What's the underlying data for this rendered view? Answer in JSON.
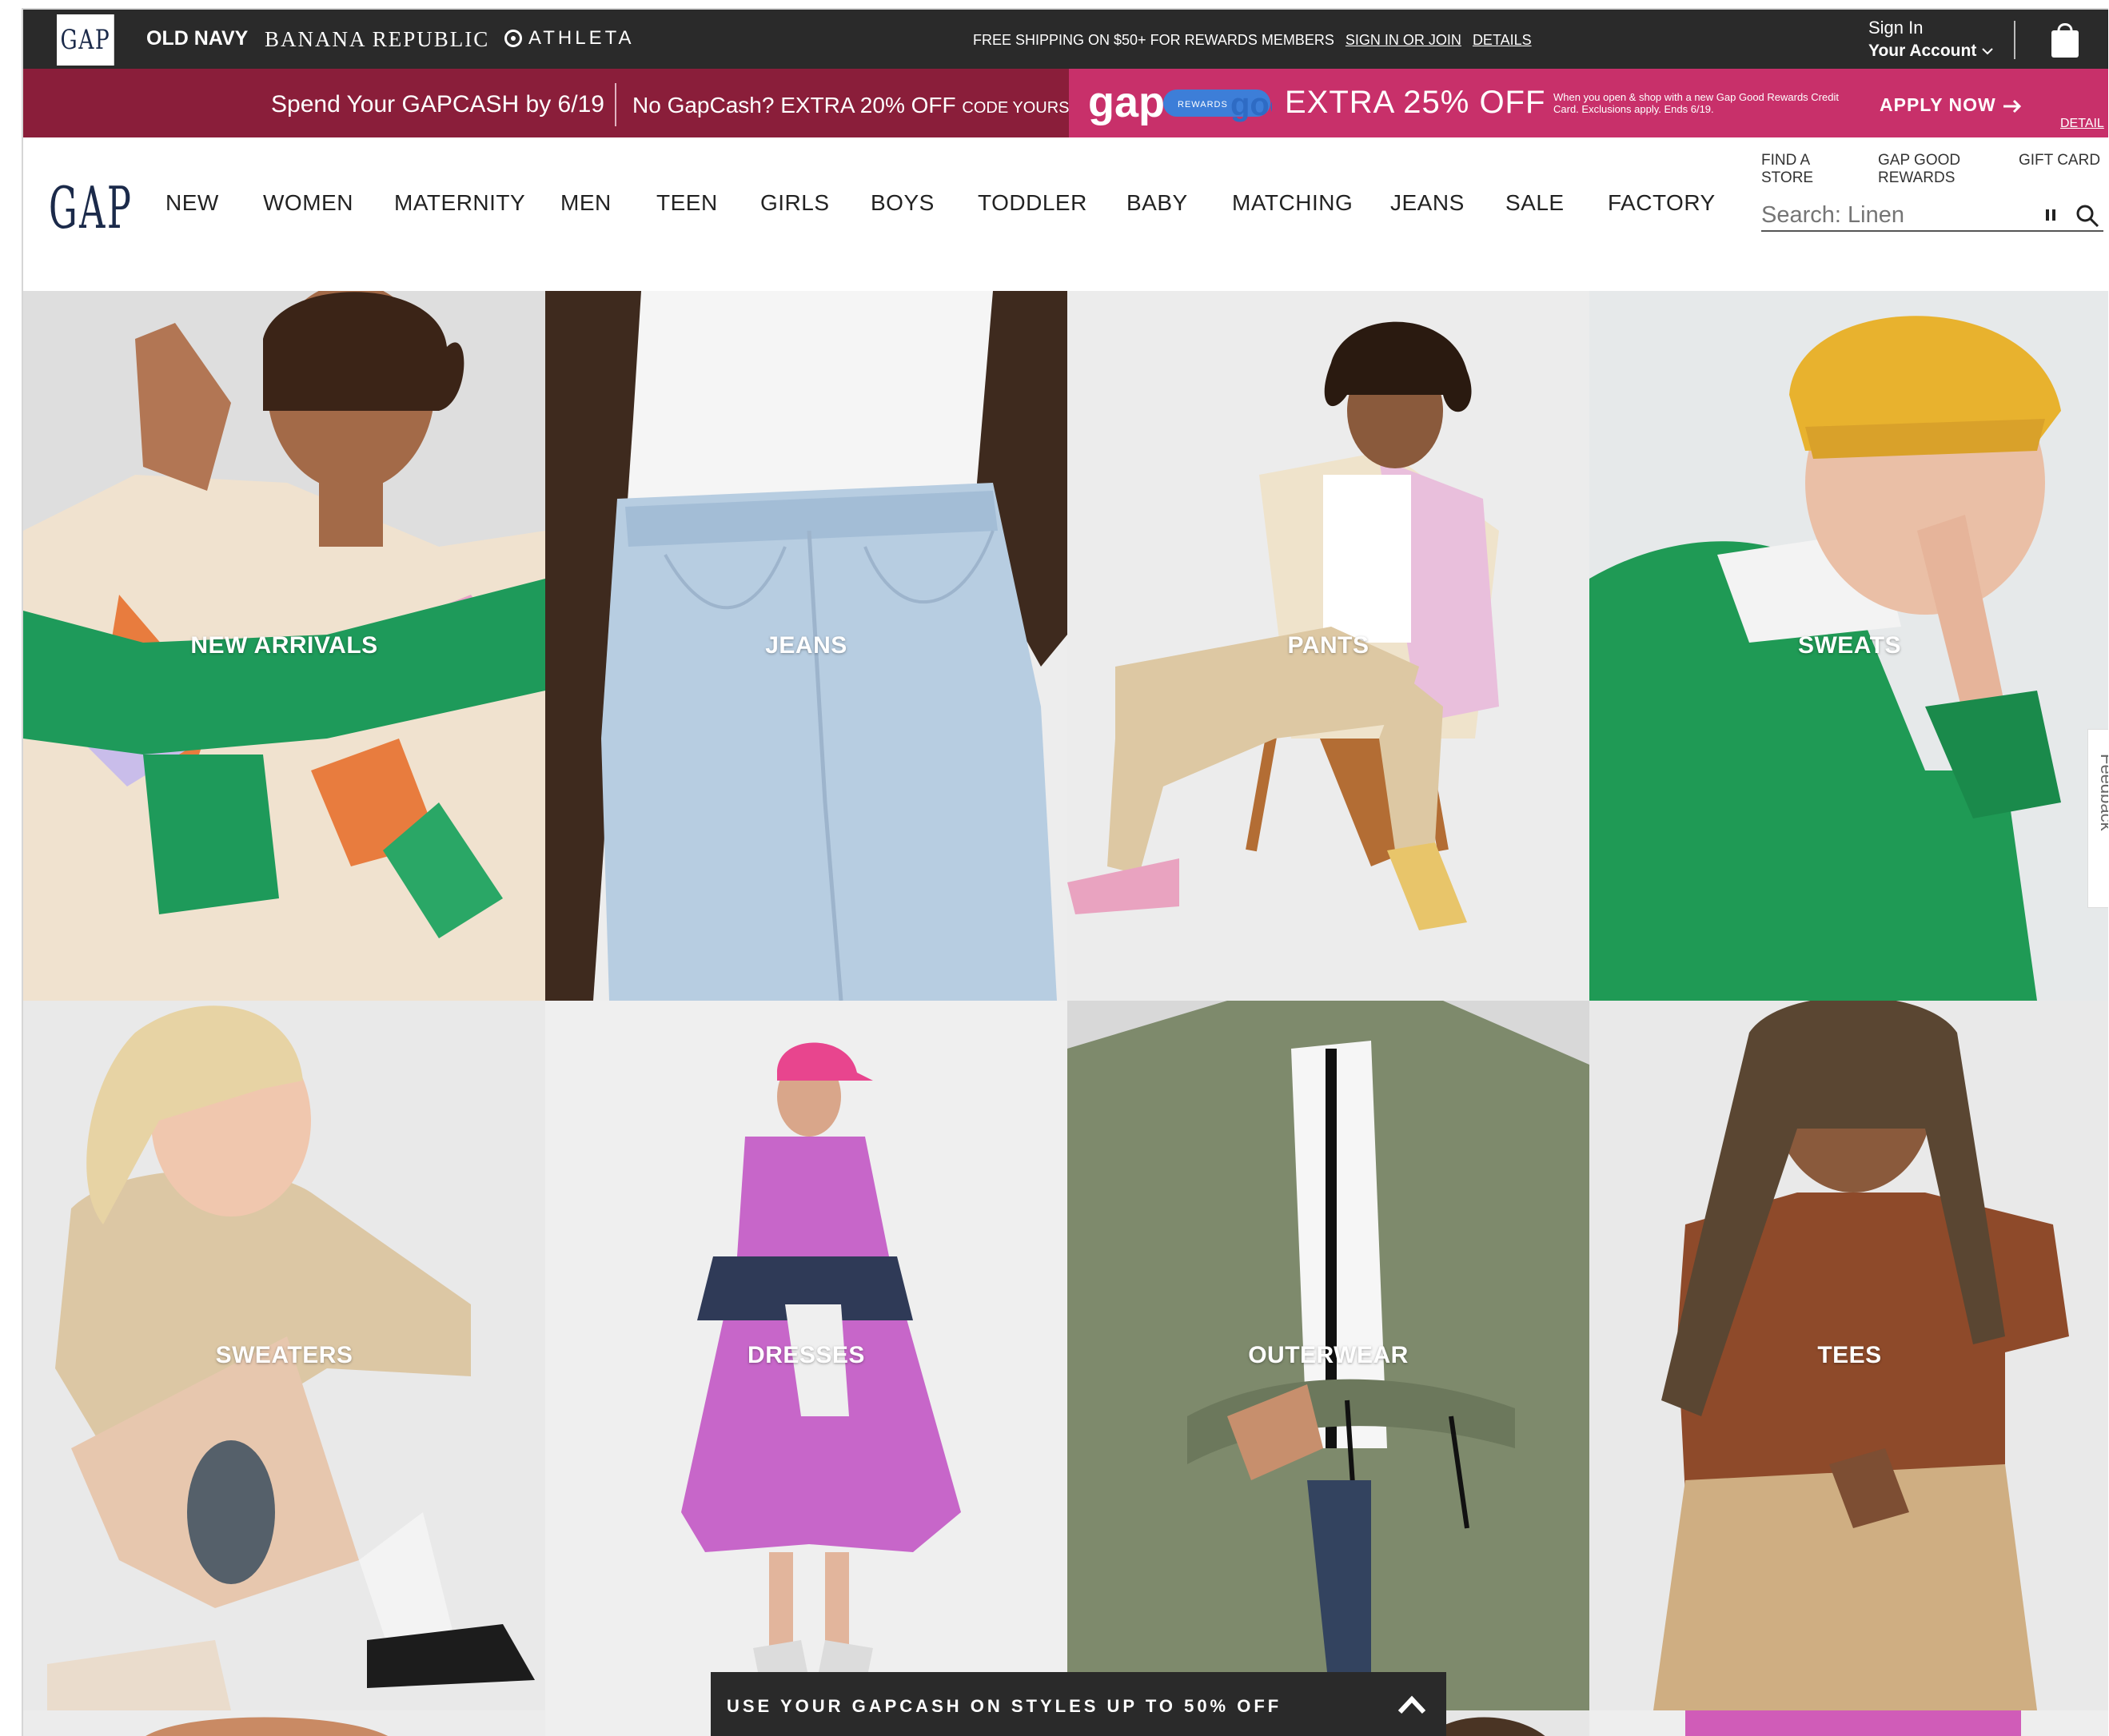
{
  "brand_bar": {
    "gap": "GAP",
    "old_navy": "OLD NAVY",
    "banana_republic": "BANANA REPUBLIC",
    "athleta": "ATHLETA",
    "shipping_text": "FREE SHIPPING ON $50+ FOR REWARDS MEMBERS",
    "sign_in_join": "SIGN IN OR JOIN",
    "details": "DETAILS",
    "sign_in": "Sign In",
    "your_account": "Your Account"
  },
  "promo_bar": {
    "spend_text": "Spend Your GAPCASH by 6/19",
    "no_gapcash": "No GapCash? EXTRA 20% OFF",
    "code": "CODE YOURS",
    "rewards_badge": "REWARDS",
    "extra_off": "EXTRA 25% OFF",
    "card_fine_print": "When you open & shop with a new Gap Good Rewards Credit Card. Exclusions apply. Ends 6/19.",
    "apply_now": "APPLY NOW",
    "details": "DETAIL"
  },
  "nav": {
    "logo": "GAP",
    "items": [
      "NEW",
      "WOMEN",
      "MATERNITY",
      "MEN",
      "TEEN",
      "GIRLS",
      "BOYS",
      "TODDLER",
      "BABY",
      "MATCHING",
      "JEANS",
      "SALE",
      "FACTORY"
    ],
    "find_store": "FIND A STORE",
    "gap_good_rewards": "GAP GOOD REWARDS",
    "gift_card": "GIFT CARD",
    "search_placeholder": "Search: Linen"
  },
  "tiles": [
    {
      "label": "NEW ARRIVALS",
      "bg": "#dcdcdc"
    },
    {
      "label": "JEANS",
      "bg": "#b9cde0"
    },
    {
      "label": "PANTS",
      "bg": "#ebebeb"
    },
    {
      "label": "SWEATS",
      "bg": "#e6e9ea"
    },
    {
      "label": "SWEATERS",
      "bg": "#e8e8e8"
    },
    {
      "label": "DRESSES",
      "bg": "#efefef"
    },
    {
      "label": "OUTERWEAR",
      "bg": "#8a9278"
    },
    {
      "label": "TEES",
      "bg": "#e9e9e9"
    }
  ],
  "feedback": "Feedback",
  "bottom_bar": {
    "text": "USE YOUR GAPCASH ON STYLES UP TO 50% OFF"
  },
  "colors": {
    "brand_bar_bg": "#2a2a2a",
    "promo_bg": "#8a1e3a",
    "promo_right_bg": "#c8306a",
    "gap_navy": "#1b2a4a"
  }
}
